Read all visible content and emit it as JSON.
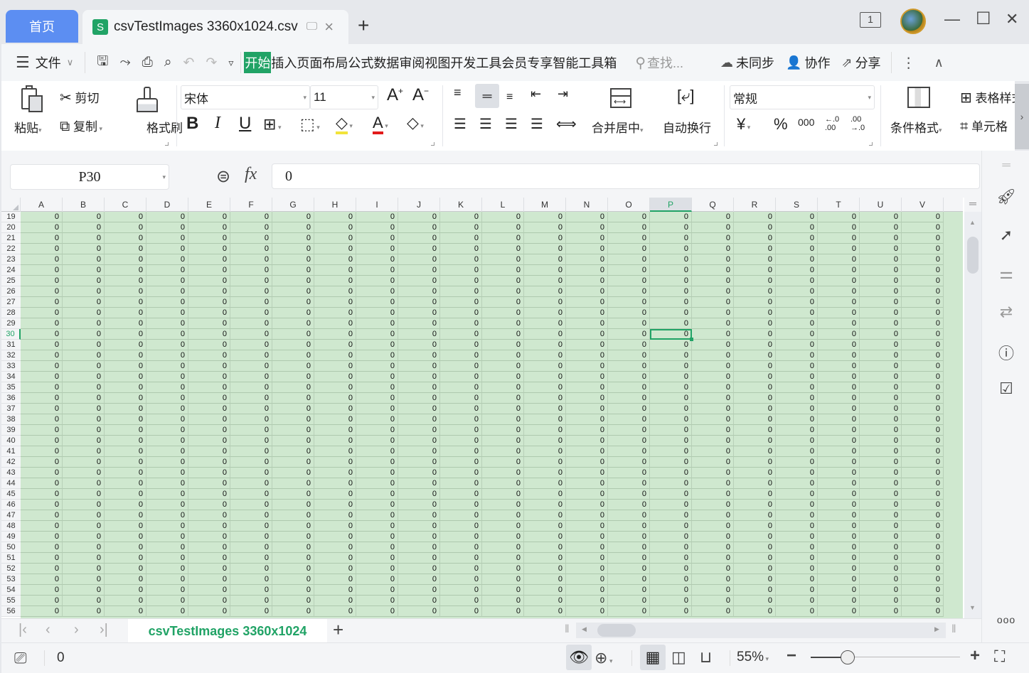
{
  "window": {
    "home_tab": "首页",
    "doc_tab": {
      "icon_letter": "S",
      "title": "csvTestImages 3360x1024.csv"
    },
    "new_tab": "+",
    "window_count": "1",
    "controls": {
      "minimize": "—",
      "maximize": "☐",
      "close": "✕"
    }
  },
  "menubar": {
    "file_label": "文件",
    "tabs": [
      "开始",
      "插入",
      "页面布局",
      "公式",
      "数据",
      "审阅",
      "视图",
      "开发工具",
      "会员专享",
      "智能工具箱"
    ],
    "active_tab": "开始",
    "search_placeholder": "查找...",
    "sync_label": "未同步",
    "collab_label": "协作",
    "share_label": "分享"
  },
  "ribbon": {
    "paste": "粘贴",
    "cut": "剪切",
    "copy": "复制",
    "format_painter": "格式刷",
    "font_name": "宋体",
    "font_size": "11",
    "bold": "B",
    "italic": "I",
    "underline": "U",
    "merge_center": "合并居中",
    "wrap_text": "自动换行",
    "number_format": "常规",
    "currency": "¥",
    "percent": "%",
    "thousands": "000",
    "dec_inc": "←.0 .00",
    "dec_dec": ".00 →.0",
    "conditional_format": "条件格式",
    "table_style": "表格样式",
    "cell_style": "单元格"
  },
  "formula_bar": {
    "name_box": "P30",
    "fx": "fx",
    "value": "0"
  },
  "grid": {
    "columns": [
      "A",
      "B",
      "C",
      "D",
      "E",
      "F",
      "G",
      "H",
      "I",
      "J",
      "K",
      "L",
      "M",
      "N",
      "O",
      "P",
      "Q",
      "R",
      "S",
      "T",
      "U",
      "V"
    ],
    "first_row": 19,
    "last_row": 56,
    "cell_value": "0",
    "selected_column": "P",
    "selected_row": 30,
    "fill_color": "#cfe8cf",
    "accent_color": "#21a366"
  },
  "sheets": {
    "tabs": [
      "csvTestImages 3360x1024"
    ],
    "active": "csvTestImages 3360x1024",
    "add": "+"
  },
  "status": {
    "value": "0",
    "zoom": "55%",
    "zoom_fraction": 0.3
  },
  "right_panel": {
    "more": "ooo"
  }
}
